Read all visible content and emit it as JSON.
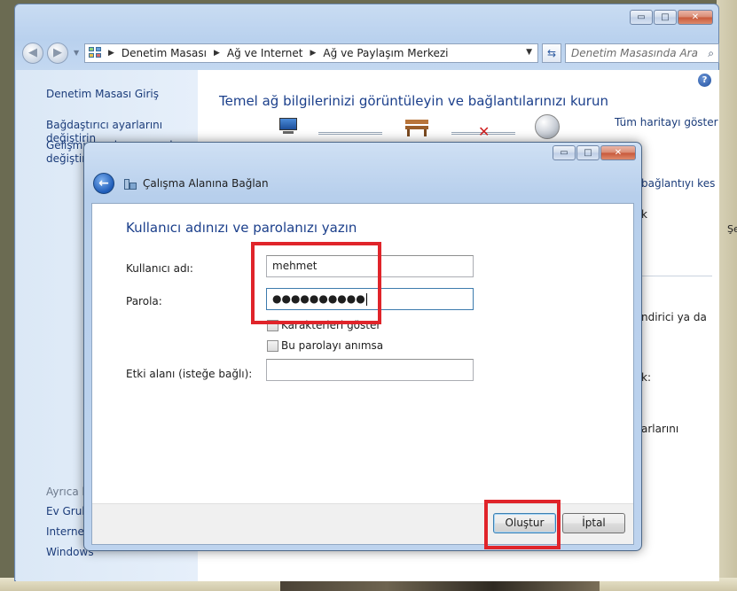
{
  "explorer": {
    "controls": {
      "minimize": "▭",
      "maximize": "□",
      "close": "✕"
    },
    "breadcrumb": [
      "Denetim Masası",
      "Ağ ve Internet",
      "Ağ ve Paylaşım Merkezi"
    ],
    "search_placeholder": "Denetim Masasında Ara",
    "icons": {
      "back": "arrow-left-icon",
      "forward": "arrow-right-icon",
      "refresh": "refresh-icon",
      "search": "search-icon",
      "help": "help-icon"
    }
  },
  "sidebar": {
    "items": [
      "Denetim Masası Giriş",
      "Bağdaştırıcı ayarlarını değiştirin",
      "Gelişmiş paylaşım ayarlarını",
      "değiştirin"
    ],
    "see_also_header": "Ayrıca b",
    "see_also": [
      "Ev Grubu",
      "Internet",
      "Windows"
    ]
  },
  "content": {
    "title": "Temel ağ bilgilerinizi görüntüleyin ve bağlantılarınızı kurun",
    "full_map_link": "Tüm haritayı göster",
    "disconnect_link": "bağlantıyı kes",
    "fragment_1": "k",
    "fragment_2": "ndirici ya da",
    "fragment_3": "k:",
    "fragment_4": "arlarını"
  },
  "dialog": {
    "title": "Çalışma Alanına Bağlan",
    "heading": "Kullanıcı adınızı ve parolanızı yazın",
    "username_label": "Kullanıcı adı:",
    "username_value": "mehmet",
    "password_label": "Parola:",
    "password_masked": "●●●●●●●●●●",
    "show_chars_label": "Karakterleri göster",
    "remember_label": "Bu parolayı anımsa",
    "domain_label": "Etki alanı (isteğe bağlı):",
    "domain_value": "",
    "create_button": "Oluştur",
    "cancel_button": "İptal"
  },
  "desktop": {
    "side_text": "Şe"
  }
}
